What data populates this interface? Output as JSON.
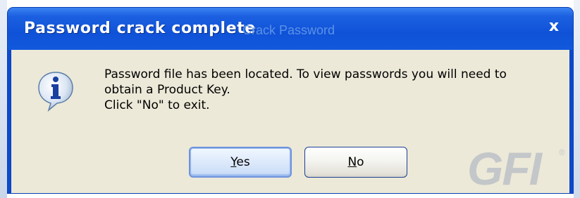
{
  "dialog": {
    "title": "Password crack complete",
    "ghost_title": "Crack Password",
    "close_label": "x",
    "message_lines": [
      "Password file has been located. To view passwords you will need to",
      "obtain a Product Key.",
      "Click \"No\" to exit."
    ],
    "buttons": {
      "yes": {
        "mnemonic": "Y",
        "rest": "es"
      },
      "no": {
        "mnemonic": "N",
        "rest": "o"
      }
    },
    "logo_text": "GFI",
    "logo_mark": "®"
  },
  "icons": {
    "info": "information-icon",
    "close": "close-icon"
  },
  "colors": {
    "titlebar": "#0f52d8",
    "client": "#ece9d8",
    "logo": "#c4c7c9"
  }
}
